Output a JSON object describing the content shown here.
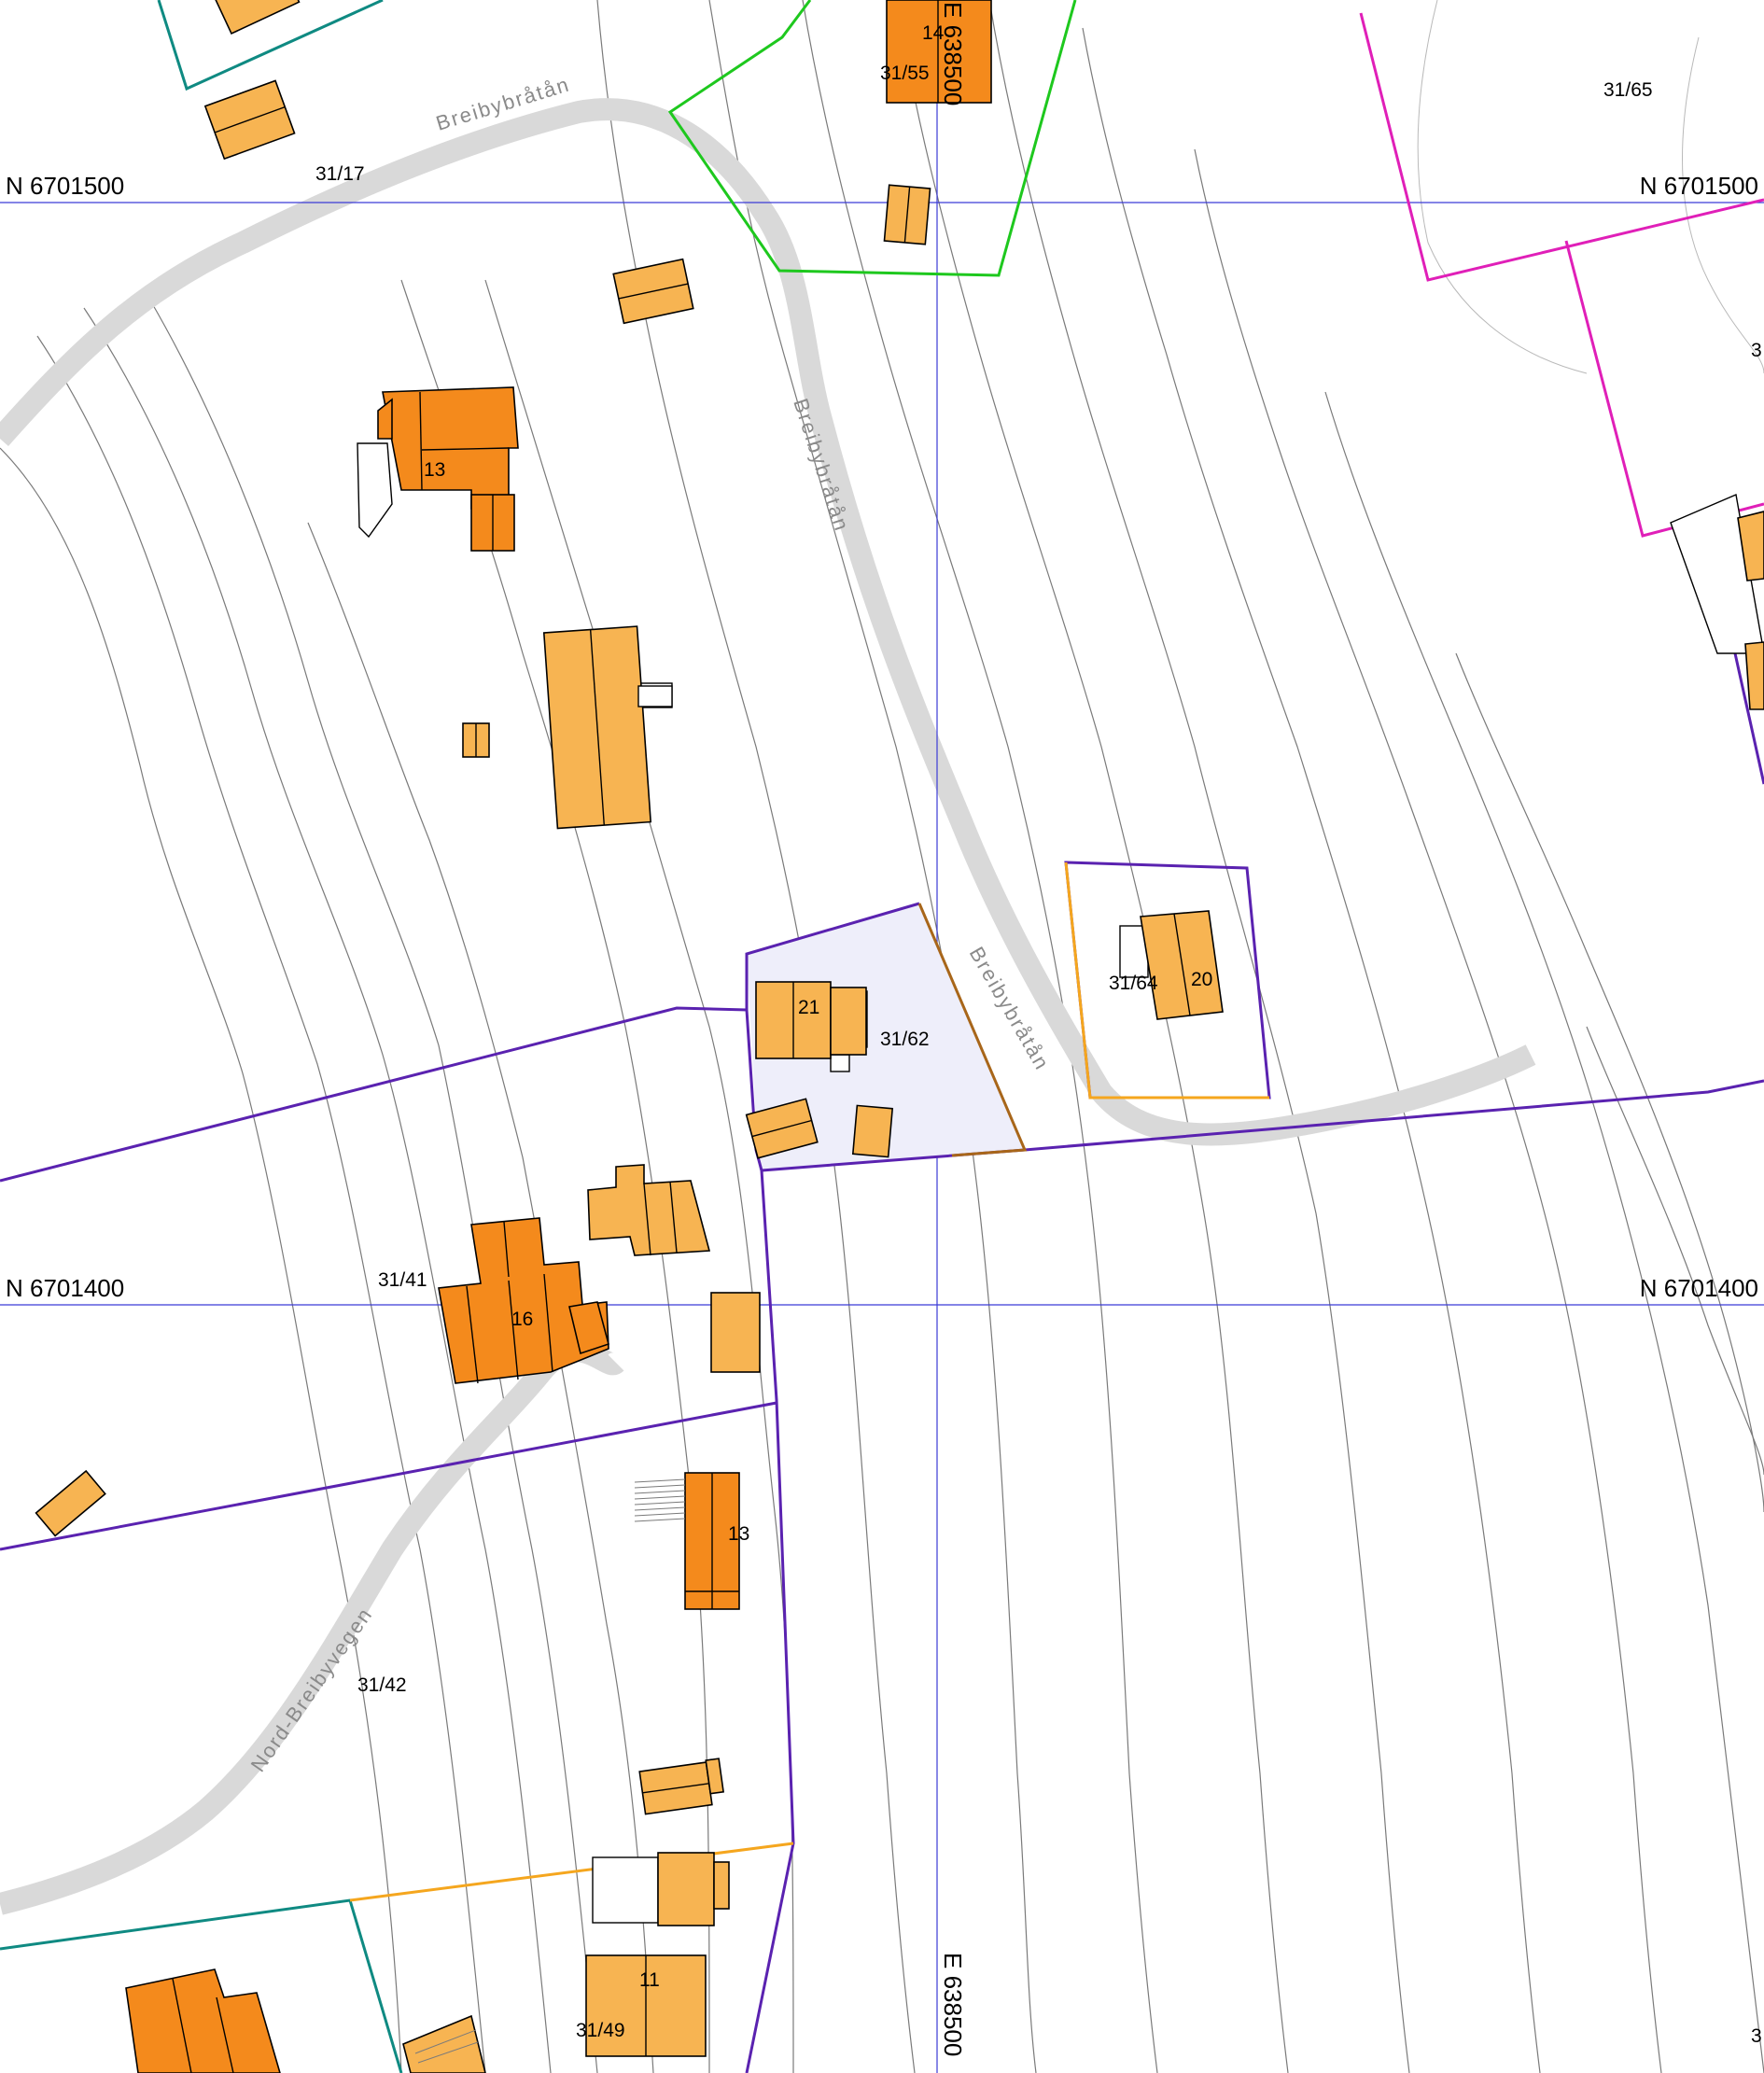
{
  "grid": {
    "n_top": "N 6701500",
    "n_bottom": "N 6701400",
    "e_label": "E 638500"
  },
  "roads": {
    "breibybratan": "Breibybråtån",
    "nord_breibyvegen": "Nord-Breibyvegen"
  },
  "parcels": {
    "p31_17": "31/17",
    "p31_55": "31/55",
    "p31_65": "31/65",
    "p31_62": "31/62",
    "p31_64": "31/64",
    "p31_41": "31/41",
    "p31_42": "31/42",
    "p31_49": "31/49",
    "edge_right_top": "3",
    "edge_right_bottom": "3"
  },
  "house_numbers": {
    "h14": "14",
    "h13_north": "13",
    "h21": "21",
    "h20": "20",
    "h16": "16",
    "h13_south": "13",
    "h11": "11"
  },
  "colors": {
    "building_light": "#f7b452",
    "building_dark": "#f48a1c",
    "road": "#d9d9d9",
    "grid_line": "#3b3bd6",
    "boundary_purple": "#5a22b0",
    "boundary_green": "#1ec81e",
    "boundary_magenta": "#e01fb8",
    "boundary_teal": "#0f8a82",
    "boundary_orange": "#f5a61e",
    "selected_fill": "#eeeefa"
  }
}
